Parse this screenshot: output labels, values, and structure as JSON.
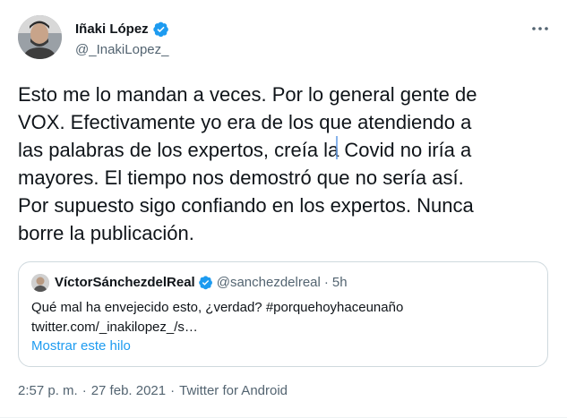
{
  "author": {
    "name": "Iñaki López",
    "handle": "@_InakiLopez_",
    "verified_icon": "verified-badge-icon",
    "avatar_icon": "avatar"
  },
  "more_icon": "more-options-icon",
  "tweet_text": "Esto me lo mandan a veces. Por lo general gente de\nVOX. Efectivamente yo era de los que atendiendo a\nlas palabras de los expertos, creía la Covid no iría a\nmayores. El tiempo nos demostró que no sería así.\nPor supuesto sigo confiando en los expertos. Nunca\nborre la publicación.",
  "quoted": {
    "name": "VíctorSánchezdelReal",
    "handle": "@sanchezdelreal",
    "separator": "·",
    "time": "5h",
    "text": "Qué mal ha envejecido esto, ¿verdad?  #porquehoyhaceunaño\ntwitter.com/_inakilopez_/s…",
    "show_thread": "Mostrar este hilo"
  },
  "meta": {
    "time": "2:57 p. m.",
    "dot1": "·",
    "date": "27 feb. 2021",
    "dot2": "·",
    "source": "Twitter for Android"
  },
  "colors": {
    "link": "#1d9bf0",
    "verified": "#1d9bf0",
    "secondary_text": "#536471",
    "border": "#cfd9de"
  }
}
